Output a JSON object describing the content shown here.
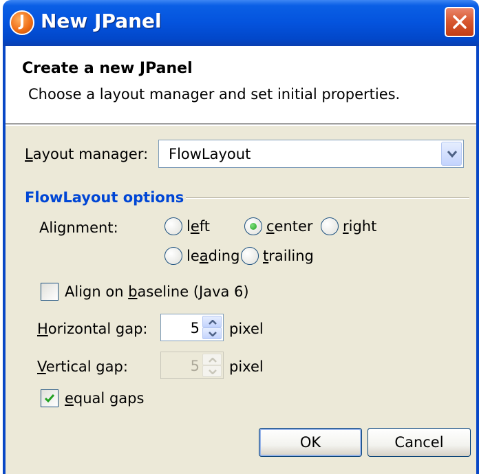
{
  "window": {
    "title": "New JPanel"
  },
  "header": {
    "title": "Create a new JPanel",
    "description": "Choose a layout manager and set initial properties."
  },
  "layout_manager": {
    "label": "Layout manager:",
    "value": "FlowLayout"
  },
  "options": {
    "section_title": "FlowLayout options",
    "alignment_label": "Alignment:",
    "alignments": [
      {
        "label": "left",
        "checked": false
      },
      {
        "label": "center",
        "checked": true
      },
      {
        "label": "right",
        "checked": false
      },
      {
        "label": "leading",
        "checked": false
      },
      {
        "label": "trailing",
        "checked": false
      }
    ],
    "align_baseline": {
      "label": "Align on baseline (Java 6)",
      "checked": false
    },
    "horizontal_gap": {
      "label": "Horizontal gap:",
      "value": "5",
      "unit": "pixel"
    },
    "vertical_gap": {
      "label": "Vertical gap:",
      "value": "5",
      "unit": "pixel",
      "enabled": false
    },
    "equal_gaps": {
      "label": "equal gaps",
      "checked": true
    }
  },
  "buttons": {
    "ok": "OK",
    "cancel": "Cancel"
  },
  "colors": {
    "titlebar": "#0453dd",
    "section_title": "#0046d5",
    "dialog_bg": "#ece9d8"
  }
}
